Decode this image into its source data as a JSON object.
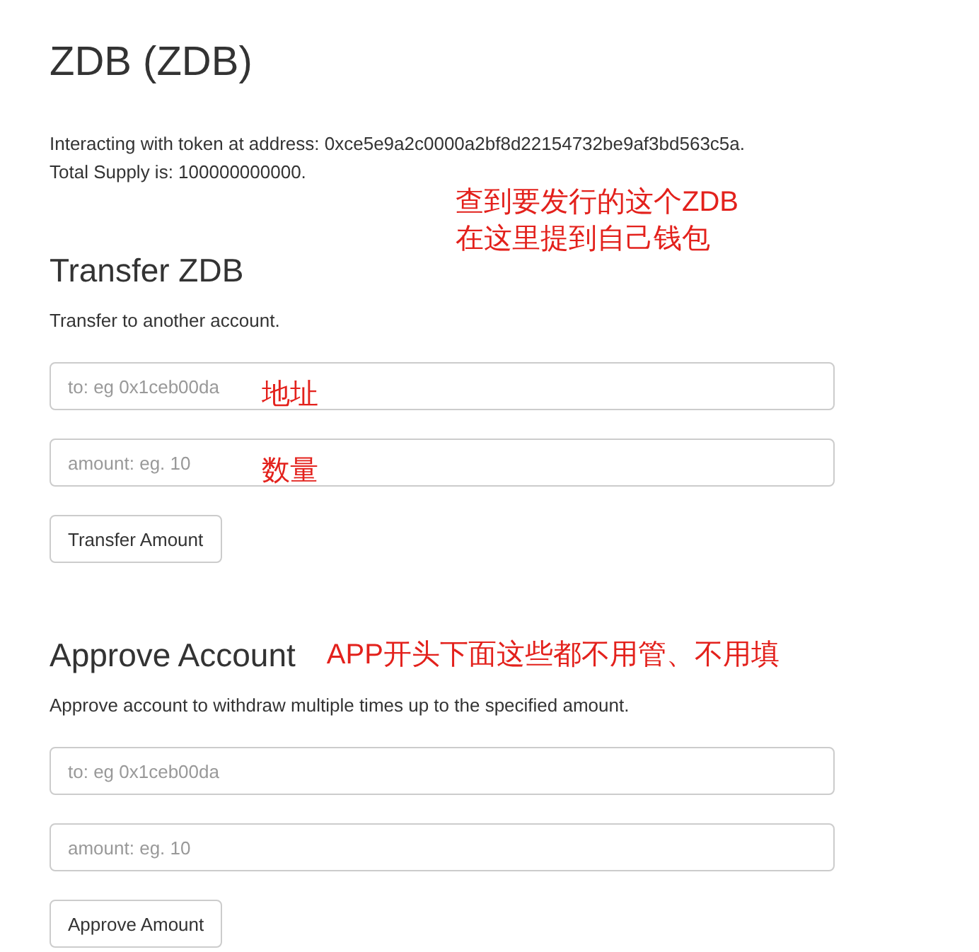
{
  "page": {
    "title": "ZDB (ZDB)",
    "info": [
      "Interacting with token at address: 0xce5e9a2c0000a2bf8d22154732be9af3bd563c5a.",
      "Total Supply is: 100000000000."
    ]
  },
  "sections": [
    {
      "heading": "Transfer ZDB",
      "note": {
        "kind": "above",
        "lines": [
          "查到要发行的这个ZDB",
          "在这里提到自己钱包"
        ]
      },
      "description": "Transfer to another account.",
      "fields": [
        {
          "placeholder": "to: eg 0x1ceb00da",
          "note": "地址"
        },
        {
          "placeholder": "amount: eg. 10",
          "note": "数量"
        }
      ],
      "button": "Transfer Amount"
    },
    {
      "heading": "Approve Account",
      "note": {
        "kind": "inline",
        "lines": [
          "APP开头下面这些都不用管、不用填"
        ]
      },
      "description": "Approve account to withdraw multiple times up to the specified amount.",
      "fields": [
        {
          "placeholder": "to: eg 0x1ceb00da"
        },
        {
          "placeholder": "amount: eg. 10"
        }
      ],
      "button": "Approve Amount"
    }
  ]
}
